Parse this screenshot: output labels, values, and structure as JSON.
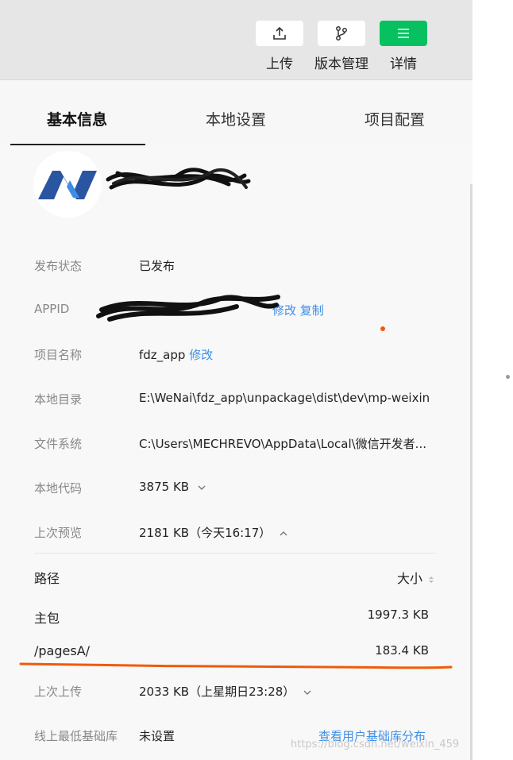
{
  "toolbar": {
    "upload_label": "上传",
    "version_label": "版本管理",
    "details_label": "详情"
  },
  "tabs": [
    "基本信息",
    "本地设置",
    "项目配置"
  ],
  "info": {
    "publish_status": {
      "label": "发布状态",
      "value": "已发布"
    },
    "appid": {
      "label": "APPID",
      "modify": "修改",
      "copy": "复制"
    },
    "project_name": {
      "label": "项目名称",
      "value": "fdz_app",
      "modify": "修改"
    },
    "local_dir": {
      "label": "本地目录",
      "value": "E:\\WeNai\\fdz_app\\unpackage\\dist\\dev\\mp-weixin"
    },
    "file_system": {
      "label": "文件系统",
      "value": "C:\\Users\\MECHREVO\\AppData\\Local\\微信开发者..."
    },
    "local_code": {
      "label": "本地代码",
      "value": "3875 KB"
    },
    "last_preview": {
      "label": "上次预览",
      "value": "2181 KB（今天16:17）"
    },
    "last_upload": {
      "label": "上次上传",
      "value": "2033 KB（上星期日23:28）"
    },
    "min_lib": {
      "label": "线上最低基础库",
      "value": "未设置",
      "link": "查看用户基础库分布"
    }
  },
  "preview_table": {
    "col_path": "路径",
    "col_size": "大小",
    "rows": [
      {
        "path": "主包",
        "size": "1997.3 KB"
      },
      {
        "path": "/pagesA/",
        "size": "183.4 KB"
      }
    ]
  },
  "watermark": "https://blog.csdn.net/weixin_459",
  "colors": {
    "accent": "#07c160",
    "link": "#3d8ee6",
    "annotation": "#f05a0a"
  }
}
